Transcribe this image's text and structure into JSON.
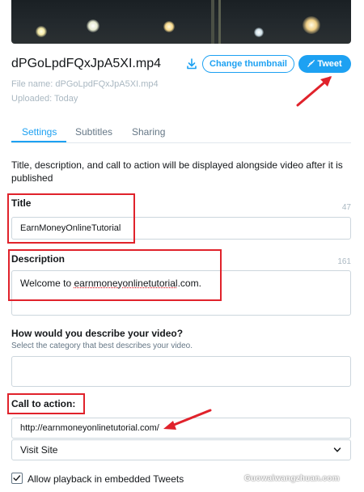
{
  "video": {
    "title": "dPGoLpdFQxJpA5XI.mp4",
    "file_name_label": "File name: dPGoLpdFQxJpA5XI.mp4",
    "uploaded_label": "Uploaded: Today"
  },
  "actions": {
    "change_thumbnail": "Change thumbnail",
    "tweet": "Tweet"
  },
  "tabs": [
    {
      "label": "Settings",
      "active": true
    },
    {
      "label": "Subtitles",
      "active": false
    },
    {
      "label": "Sharing",
      "active": false
    }
  ],
  "intro": "Title, description, and call to action will be displayed alongside video after it is published",
  "fields": {
    "title": {
      "label": "Title",
      "counter": "47",
      "value": "EarnMoneyOnlineTutorial"
    },
    "description": {
      "label": "Description",
      "counter": "161",
      "value_prefix": "Welcome to ",
      "value_link": "earnmoneyonlinetutorial",
      "value_suffix": ".com."
    },
    "category": {
      "label": "How would you describe your video?",
      "hint": "Select the category that best describes your video.",
      "value": ""
    },
    "call_to_action": {
      "label": "Call to action:",
      "url": "http://earnmoneyonlinetutorial.com/",
      "select_value": "Visit Site"
    }
  },
  "checkbox": {
    "label": "Allow playback in embedded Tweets",
    "checked": true
  },
  "watermark": "Guowaiwangzhuan.com",
  "colors": {
    "accent": "#1da1f2",
    "annotation": "#e0222b"
  },
  "icons": [
    "download-icon",
    "tweet-feather-icon",
    "chevron-down-icon",
    "checkmark-icon"
  ]
}
